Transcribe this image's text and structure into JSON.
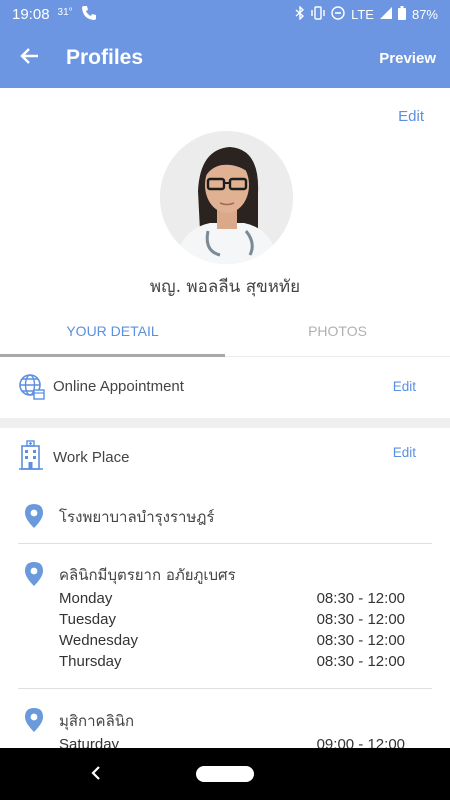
{
  "status_bar": {
    "time": "19:08",
    "temperature": "31°",
    "network": "LTE",
    "battery": "87%"
  },
  "header": {
    "title": "Profiles",
    "preview_label": "Preview"
  },
  "profile": {
    "edit_label": "Edit",
    "name": "พญ. พอลลีน สุขหทัย"
  },
  "tabs": [
    {
      "label": "YOUR DETAIL",
      "active": true
    },
    {
      "label": "PHOTOS",
      "active": false
    }
  ],
  "online_appointment": {
    "label": "Online Appointment",
    "edit_label": "Edit"
  },
  "work_place": {
    "label": "Work Place",
    "edit_label": "Edit",
    "places": [
      {
        "name": "โรงพยาบาลบำรุงราษฎร์",
        "hours": []
      },
      {
        "name": "คลินิกมีบุตรยาก อภัยภูเบศร",
        "hours": [
          {
            "day": "Monday",
            "time": "08:30 - 12:00"
          },
          {
            "day": "Tuesday",
            "time": "08:30 - 12:00"
          },
          {
            "day": "Wednesday",
            "time": "08:30 - 12:00"
          },
          {
            "day": "Thursday",
            "time": "08:30 - 12:00"
          }
        ]
      },
      {
        "name": "มุสิกาคลินิก",
        "hours": [
          {
            "day": "Saturday",
            "time": "09:00 - 12:00"
          }
        ]
      }
    ]
  },
  "colors": {
    "primary": "#6c96e2",
    "link": "#5b8fe0",
    "pin": "#6a99dc"
  }
}
